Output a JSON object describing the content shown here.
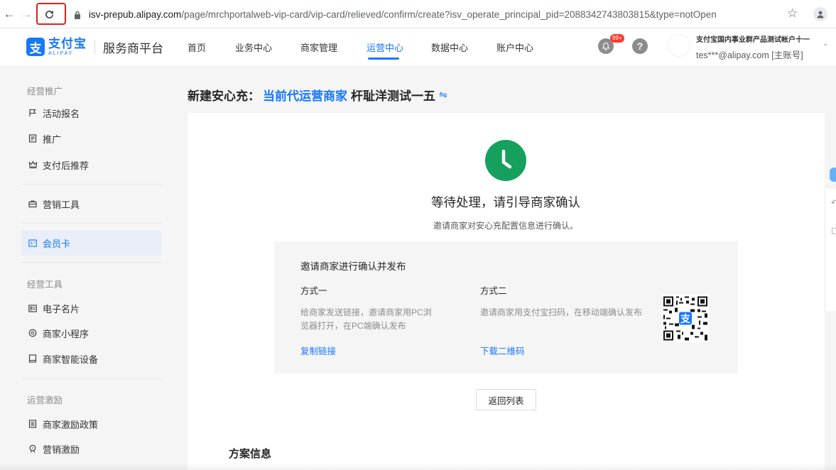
{
  "browser": {
    "url_host": "isv-prepub.alipay.com",
    "url_path": "/page/mrchportalweb-vip-card/vip-card/relieved/confirm/create?isv_operate_principal_pid=2088342743803815&type=notOpen"
  },
  "header": {
    "logo_mark": "支",
    "logo_cn": "支付宝",
    "logo_en": "ALIPAY",
    "platform_name": "服务商平台",
    "nav": [
      "首页",
      "业务中心",
      "商家管理",
      "运营中心",
      "数据中心",
      "账户中心"
    ],
    "active_nav": "运营中心",
    "notification_badge": "99+",
    "help_glyph": "?",
    "account_name": "支付宝国内事业群产品测试帐户十一",
    "account_email": "tes***@alipay.com [主账号]"
  },
  "sidebar": {
    "group1": "经营推广",
    "item_activity": "活动报名",
    "item_promo": "推广",
    "item_after_pay": "支付后推荐",
    "item_marketing_tools": "营销工具",
    "item_member_card": "会员卡",
    "group2": "经营工具",
    "item_ecard": "电子名片",
    "item_mini_program": "商家小程序",
    "item_smart_device": "商家智能设备",
    "group3": "运营激励",
    "item_incentive_policy": "商家激励政策",
    "item_marketing_incentive": "营销激励"
  },
  "main": {
    "title_prefix": "新建安心充：",
    "title_link": "当前代运营商家",
    "title_merchant": "杆耻洋测试一五",
    "swap_glyph": "⇋",
    "status_title": "等待处理，请引导商家确认",
    "status_subtitle": "邀请商家对安心充配置信息进行确认。",
    "box_heading": "邀请商家进行确认并发布",
    "way1_label": "方式一",
    "way1_desc_line1": "给商家发送链接，邀请商家用PC浏",
    "way1_desc_line2": "览器打开，在PC端确认发布",
    "way1_link": "复制链接",
    "way2_label": "方式二",
    "way2_desc": "邀请商家用支付宝扫码，在移动端确认发布",
    "way2_link": "下载二维码",
    "back_button": "返回列表",
    "section_title": "方案信息"
  },
  "colors": {
    "accent": "#1677ff",
    "success": "#16a05d",
    "highlight_box": "#e02020"
  }
}
